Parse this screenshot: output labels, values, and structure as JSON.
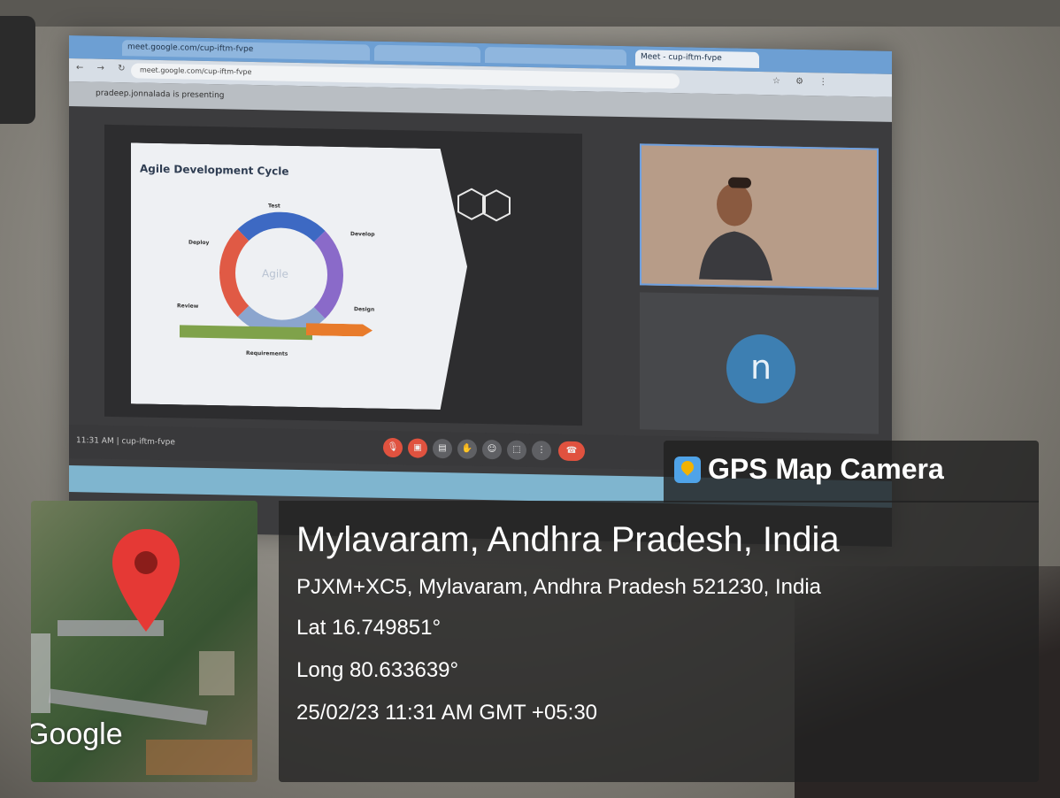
{
  "browser": {
    "tabs": [
      {
        "label": "meet.google.com/cup-iftm-fvpe"
      },
      {
        "label": ""
      },
      {
        "label": ""
      },
      {
        "label": "Meet - cup-iftm-fvpe"
      }
    ],
    "url": "meet.google.com/cup-iftm-fvpe",
    "presenting_banner": "pradeep.jonnalada is presenting"
  },
  "slide": {
    "title": "Agile Development Cycle",
    "center_label": "Agile",
    "stages": [
      {
        "label": "Test"
      },
      {
        "label": "Develop"
      },
      {
        "label": "Design"
      },
      {
        "label": "Requirements"
      },
      {
        "label": "Review"
      },
      {
        "label": "Deploy"
      }
    ]
  },
  "participants": {
    "second_avatar_letter": "n"
  },
  "meet_bar": {
    "time": "11:31 AM",
    "meeting_code": "cup-iftm-fvpe"
  },
  "gps": {
    "app_name": "GPS Map Camera",
    "place": "Mylavaram, Andhra Pradesh, India",
    "address": "PJXM+XC5, Mylavaram, Andhra Pradesh 521230, India",
    "lat": "Lat 16.749851°",
    "long": "Long 80.633639°",
    "datetime": "25/02/23 11:31 AM GMT +05:30",
    "map_brand": "Google"
  },
  "colors": {
    "gps_panel": "#212121",
    "map_pin": "#e53935",
    "meet_leave": "#e0523f",
    "avatar": "#3d7fb2"
  }
}
